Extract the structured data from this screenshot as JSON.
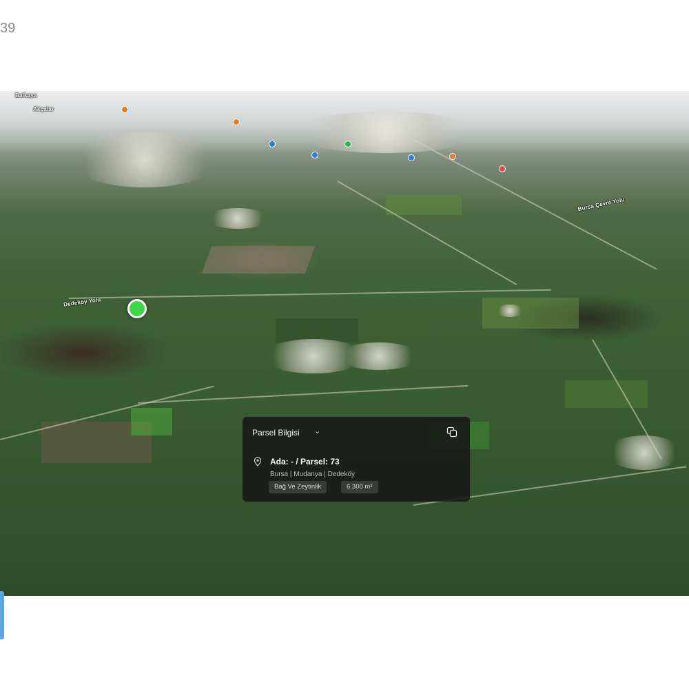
{
  "header": {
    "counter": "39"
  },
  "map": {
    "labels": {
      "l1": "Balkaya",
      "l2": "Akçalar",
      "l3": "Dedeköy Yolu",
      "l4": "Bursa Çevre Yolu"
    }
  },
  "panel": {
    "title": "Parsel Bilgisi",
    "parcel": "Ada: - / Parsel: 73",
    "location": "Bursa | Mudanya | Dedeköy",
    "land_use": "Bağ Ve Zeytinlik",
    "area": "6.300 m²"
  },
  "colors": {
    "pin": "#3fd44a",
    "panel_bg": "#181818",
    "side_tab": "#5aa7dd"
  },
  "icons": [
    "chevron-down-icon",
    "copy-icon",
    "location-icon",
    "parcel-pin-icon"
  ]
}
